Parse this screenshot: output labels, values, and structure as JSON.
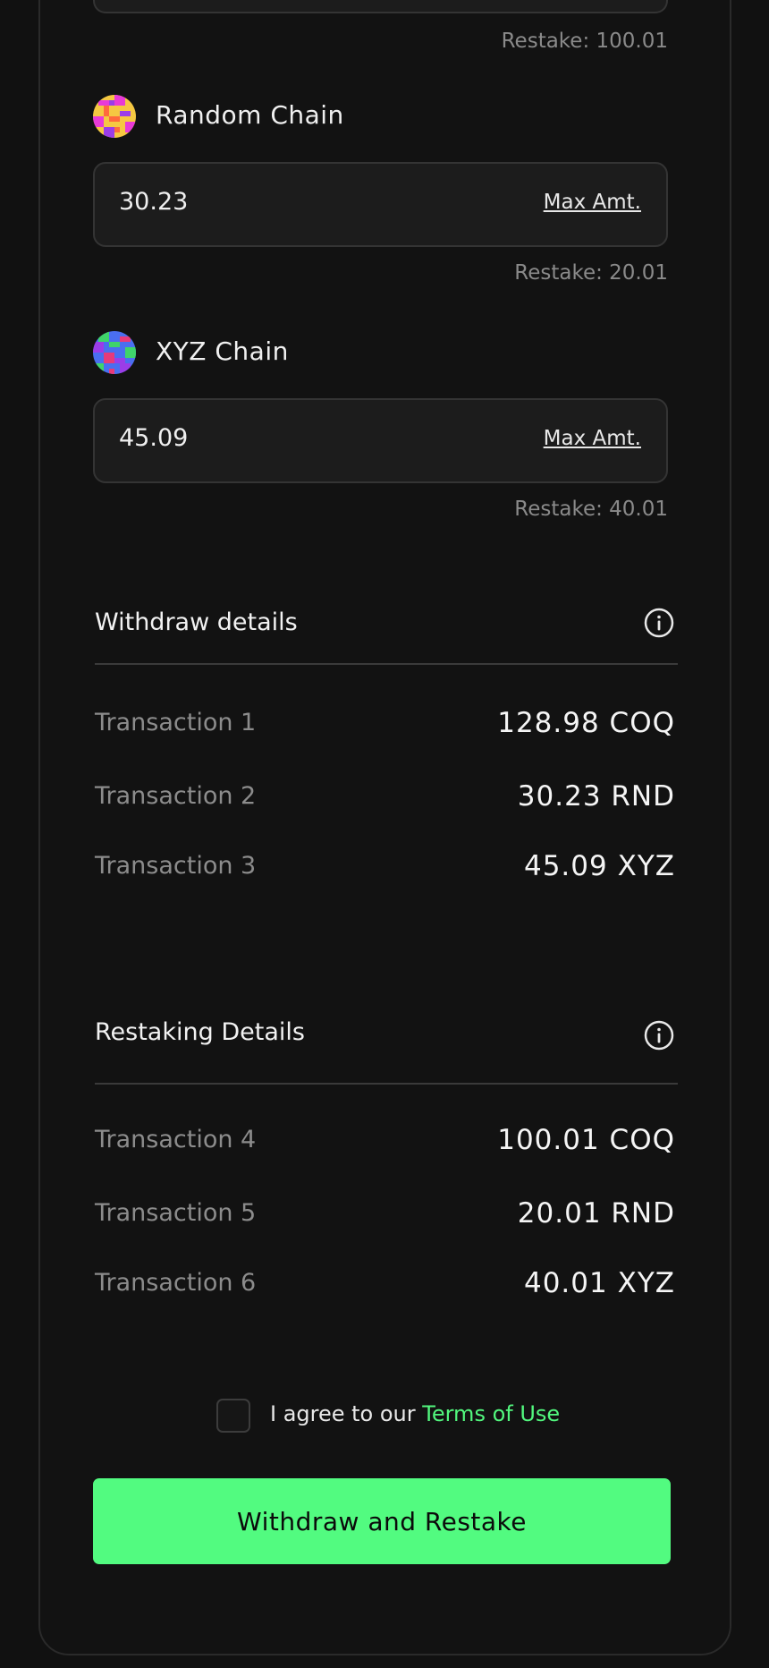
{
  "chains": [
    {
      "name": "",
      "restake": "Restake: 100.01"
    },
    {
      "name": "Random Chain",
      "value": "30.23",
      "max_label": "Max Amt.",
      "restake": "Restake: 20.01",
      "icon": "pixel-avatar-icon"
    },
    {
      "name": "XYZ Chain",
      "value": "45.09",
      "max_label": "Max Amt.",
      "restake": "Restake: 40.01",
      "icon": "pixel-avatar-icon"
    }
  ],
  "withdraw": {
    "title": "Withdraw details",
    "rows": [
      {
        "label": "Transaction 1",
        "value": "128.98 COQ"
      },
      {
        "label": "Transaction 2",
        "value": "30.23 RND"
      },
      {
        "label": "Transaction 3",
        "value": "45.09 XYZ"
      }
    ]
  },
  "restaking": {
    "title": "Restaking Details",
    "rows": [
      {
        "label": "Transaction 4",
        "value": "100.01 COQ"
      },
      {
        "label": "Transaction 5",
        "value": "20.01 RND"
      },
      {
        "label": "Transaction 6",
        "value": "40.01 XYZ"
      }
    ]
  },
  "agreement": {
    "prefix": "I agree to our ",
    "link": "Terms of Use"
  },
  "cta": {
    "label": "Withdraw and Restake"
  },
  "colors": {
    "accent": "#52fb80",
    "background": "#111111",
    "muted_text": "#8c8c8c"
  }
}
